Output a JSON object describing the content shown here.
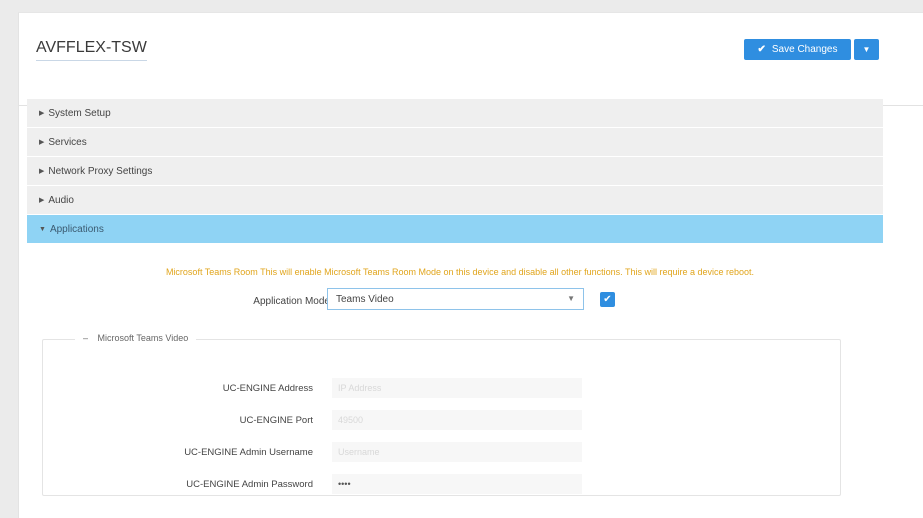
{
  "header": {
    "device_name": "AVFFLEX-TSW",
    "save_label": "Save Changes"
  },
  "sections": [
    {
      "label": "System Setup"
    },
    {
      "label": "Services"
    },
    {
      "label": "Network Proxy Settings"
    },
    {
      "label": "Audio"
    },
    {
      "label": "Applications"
    }
  ],
  "applications": {
    "warning": "Microsoft Teams Room This will enable Microsoft Teams Room Mode on this device and disable all other functions. This will require a device reboot.",
    "mode_label": "Application Mode",
    "mode_value": "Teams Video",
    "mode_enabled": true,
    "group_title": "Microsoft Teams Video",
    "fields": [
      {
        "label": "UC-ENGINE Address",
        "placeholder": "IP Address",
        "value": ""
      },
      {
        "label": "UC-ENGINE Port",
        "placeholder": "49500",
        "value": ""
      },
      {
        "label": "UC-ENGINE Admin Username",
        "placeholder": "Username",
        "value": ""
      },
      {
        "label": "UC-ENGINE Admin Password",
        "placeholder": "",
        "value": "••••"
      }
    ]
  }
}
